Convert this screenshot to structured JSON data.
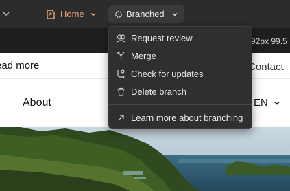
{
  "toolbar": {
    "home_label": "Home",
    "branch_label": "Branched",
    "accent_color": "#f0a772"
  },
  "canvas": {
    "size_readout": "92px 99.5"
  },
  "site": {
    "read_more": "ead more",
    "contact": "Contact",
    "about": "About",
    "language": "EN"
  },
  "branch_menu": {
    "items": [
      {
        "label": "Request review",
        "icon": "request-review-icon"
      },
      {
        "label": "Merge",
        "icon": "merge-icon"
      },
      {
        "label": "Check for updates",
        "icon": "check-updates-icon"
      },
      {
        "label": "Delete branch",
        "icon": "trash-icon"
      },
      {
        "label": "Learn more about branching",
        "icon": "arrow-up-right-icon"
      }
    ]
  }
}
